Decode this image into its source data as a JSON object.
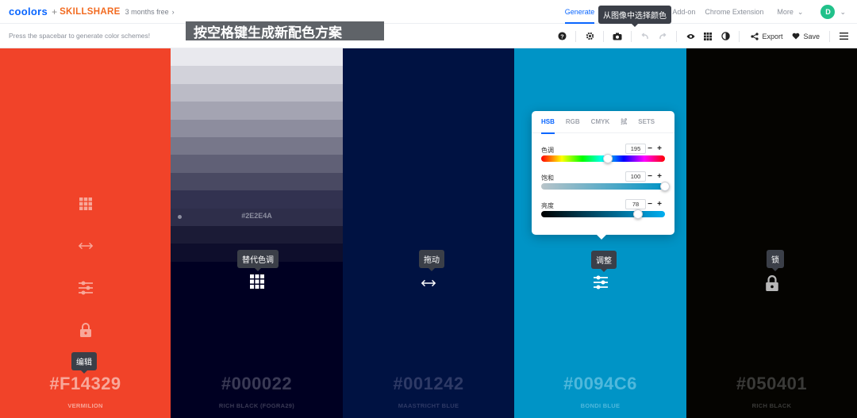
{
  "nav": {
    "logo": "coolors",
    "plus": "+",
    "partner": "SKILLSHARE",
    "promo": "3 months free",
    "promo_chevron": "›",
    "links": [
      "Generate",
      "E",
      "Add-on",
      "Chrome Extension",
      "More"
    ],
    "more_chevron": "⌄",
    "avatar": "D",
    "avatar_chevron": "⌄",
    "colors": {
      "brand": "#0a66ff",
      "partner": "#f26b21",
      "avatar": "#21c18a"
    }
  },
  "toolbar": {
    "hint": "Press the spacebar to generate color schemes!",
    "icons": {
      "help": "help-icon",
      "settings": "gear-icon",
      "camera": "camera-icon",
      "undo": "undo-icon",
      "redo": "redo-icon",
      "view": "eye-icon",
      "grid": "grid-icon",
      "contrast": "contrast-icon",
      "share": "share-icon",
      "save": "heart-icon",
      "menu": "menu-icon"
    },
    "export_label": "Export",
    "save_label": "Save"
  },
  "annotations": {
    "main": "按空格键生成新配色方案",
    "camera_tip": "从图像中选择颜色",
    "edit_tip": "编辑",
    "shades_tip": "替代色调",
    "drag_tip": "拖动",
    "adjust_tip": "调整",
    "lock_tip": "锁"
  },
  "palette": [
    {
      "hex": "#F14329",
      "name": "VERMILION",
      "bg": "#F14329",
      "text": "#f8a799",
      "icon_color": "#f8a799"
    },
    {
      "hex": "#000022",
      "name": "RICH BLACK (FOGRA29)",
      "bg": "#000022",
      "text": "#3a3a55",
      "icon_color": "#ffffff"
    },
    {
      "hex": "#001242",
      "name": "MAASTRICHT BLUE",
      "bg": "#001242",
      "text": "#2e3a66",
      "icon_color": "#ffffff"
    },
    {
      "hex": "#0094C6",
      "name": "BONDI BLUE",
      "bg": "#0094C6",
      "text": "#4fb8dc",
      "icon_color": "#ffffff"
    },
    {
      "hex": "#050401",
      "name": "RICH BLACK",
      "bg": "#050401",
      "text": "#3a3a38",
      "icon_color": "#b7b7b7"
    }
  ],
  "shades": {
    "selected": "#2E2E4A",
    "colors": [
      "#e9e9ee",
      "#d2d2da",
      "#bbbbc6",
      "#a4a4b2",
      "#8d8d9e",
      "#77778a",
      "#606076",
      "#494962",
      "#323250",
      "#2e2e4a",
      "#1b1b36",
      "#0e0e2c"
    ]
  },
  "picker": {
    "tabs": [
      "HSB",
      "RGB",
      "CMYK",
      "拭",
      "SETS"
    ],
    "active_tab": "HSB",
    "minus": "−",
    "plus": "+",
    "hue": {
      "label": "色调",
      "value": "195",
      "fraction": 0.54
    },
    "saturation": {
      "label": "饱和",
      "value": "100",
      "fraction": 1.0
    },
    "brightness": {
      "label": "亮度",
      "value": "78",
      "fraction": 0.78
    }
  }
}
